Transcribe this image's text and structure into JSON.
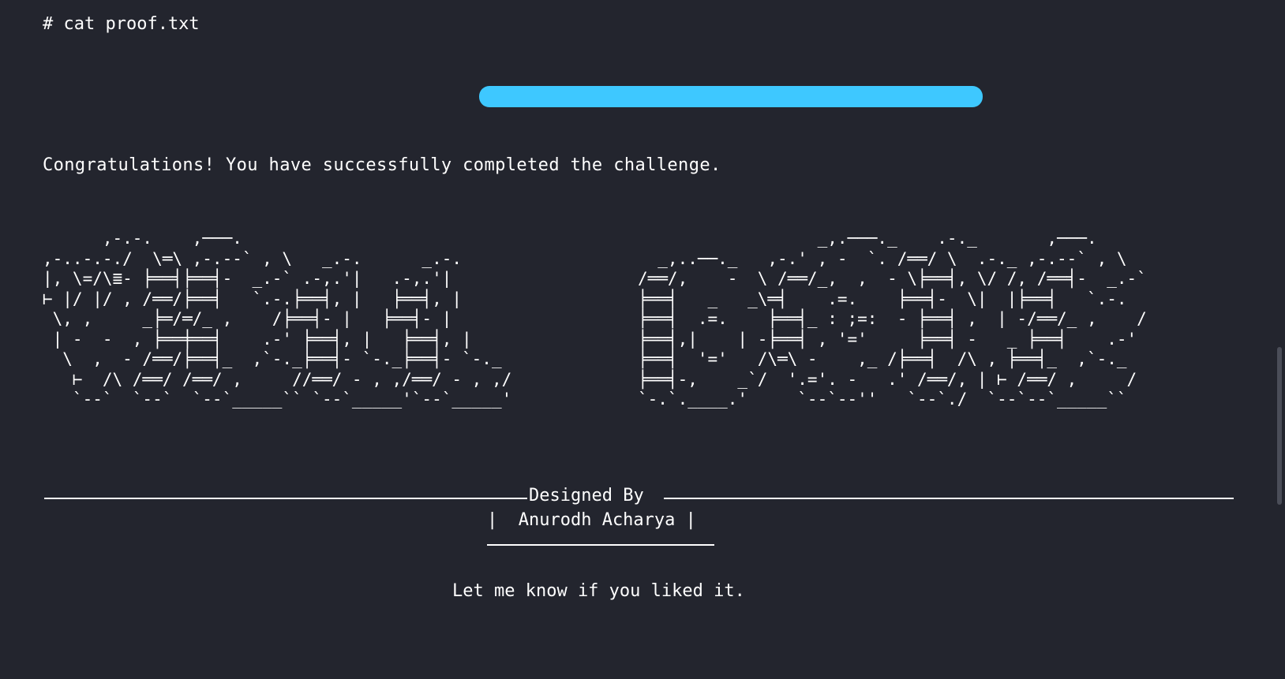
{
  "terminal": {
    "command": "# cat proof.txt",
    "congrats": "Congratulations! You have successfully completed the challenge.",
    "ascii_left": "      ,-.-.    ,───.\n,-..-.-./  \\═\\ ,-.--` , \\   _.-.      _.-.\n|, \\=/\\≣- ╞══╡╞══╡-  _.-` .-,.'|   .-,.'|\n⊢ |/ |/ , /══/╞══╡   `.-.╞══╡, |   ╞══╡, |\n \\, ,     _╞═/═/_ ,    /╞══╡- |   ╞══╡- |\n | -  -  , ╞══╪══╡    .-' ╞══╡, |   ╞══╡, |\n  \\  ,  - /══/╞══╡_  ,`-._╞══╡- `-._╞══╡- `-._\n   ⊢  /\\ /══/ /══/ ,     //══/ - , ,/══/ - , ,/\n   `--`  `--`  `--`_____`` `--`_____'`--`_____'",
    "ascii_right": "                  _,.───._    .-._       ,───.\n  _,..──._   ,-.' , -  `. /══/ \\  .-._ ,-.--` , \\\n/══/,    -  \\ /══/_,  ,  - \\╞══╡, \\/ /, /══╡-  _.-`\n╞══╡   _   _\\═╡    .=.    ╞══╡-  \\|  |╞══╡   `.-.\n╞══╡  .=.    ╞══╡_ : ;=:  - ╞══╡ ,  | -/══/_ ,    /\n╞══╡,|    | -╞══╡ , '='     ╞══╡ -   _ ╞══╡    .-'\n╞══╡  '='   /\\═\\ -    ,_ /╞══╡  /\\ , ╞══╡_  ,`-._\n╞══╡-,    _`/  '.='. -   .' /══/, | ⊢ /══/ ,     /\n`-.`.____.'     `--`--''   `--`./  `--`--`_____``",
    "designed_by_label": "Designed By",
    "author": "|  Anurodh Acharya |",
    "footer": "Let me know if you liked it.",
    "accent_color": "#3ec8ff"
  }
}
